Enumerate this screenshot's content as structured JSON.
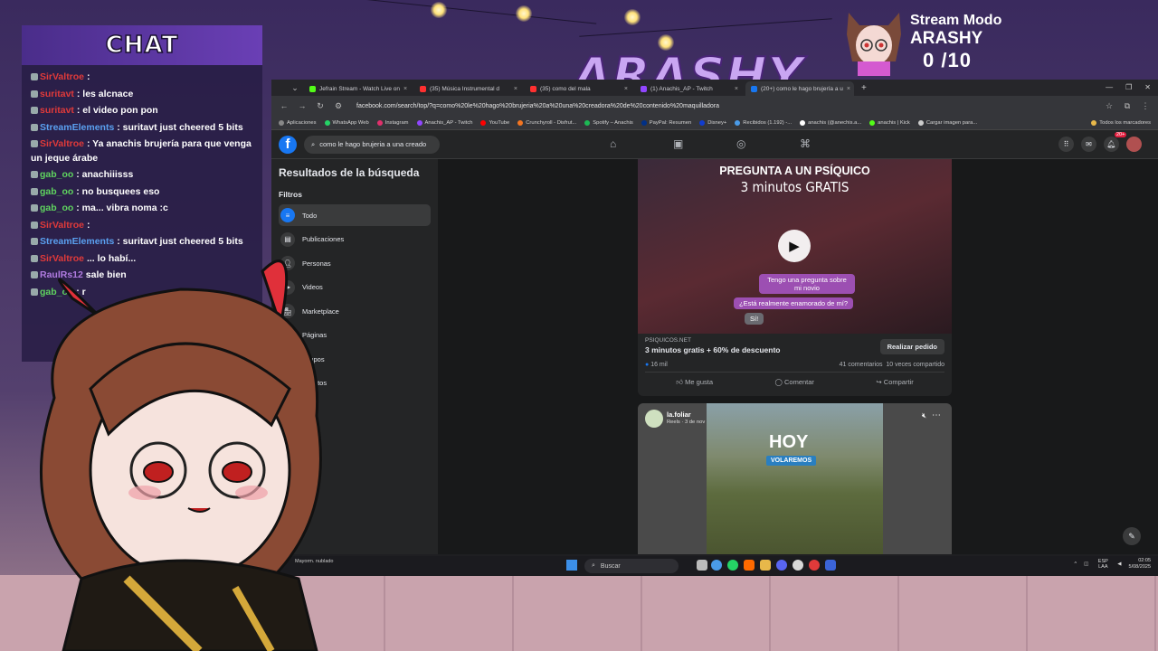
{
  "chat": {
    "title": "CHAT",
    "messages": [
      {
        "user": "SirValtroe",
        "text": ":",
        "user_color": "red"
      },
      {
        "user": "suritavt",
        "text": ": les alcnace",
        "user_color": "red"
      },
      {
        "user": "suritavt",
        "text": ": el video pon pon",
        "user_color": "red"
      },
      {
        "user": "StreamElements",
        "text": ": suritavt just cheered 5 bits",
        "user_color": "blue"
      },
      {
        "user": "SirValtroe",
        "text": ": Ya anachis brujería para que venga un jeque árabe",
        "user_color": "red"
      },
      {
        "user": "gab_oo",
        "text": ": anachiiisss",
        "user_color": "green"
      },
      {
        "user": "gab_oo",
        "text": ": no busquees eso",
        "user_color": "green"
      },
      {
        "user": "gab_oo",
        "text": ": ma... vibra noma :c",
        "user_color": "green"
      },
      {
        "user": "SirValtroe",
        "text": ":",
        "user_color": "red"
      },
      {
        "user": "StreamElements",
        "text": ": suritavt just cheered 5 bits",
        "user_color": "blue"
      },
      {
        "user": "SirValtroe",
        "text": "... lo habí...",
        "user_color": "red"
      },
      {
        "user": "RaulRs12",
        "text": "sale bien",
        "user_color": "purple"
      },
      {
        "user": "gab_oo",
        "text": ": r",
        "user_color": "green"
      }
    ]
  },
  "overlay": {
    "logo": "ARASHY",
    "mode_label": "Stream Modo",
    "mode_name": "ARASHY",
    "counter": "0  /10"
  },
  "browser": {
    "tabs": [
      {
        "label": "Jefrain Stream - Watch Live on",
        "color": "#53fc18"
      },
      {
        "label": "(35) Música Instrumental d",
        "color": "#ff3030"
      },
      {
        "label": "(35) como del mala",
        "color": "#ff3030"
      },
      {
        "label": "(1) Anachis_AP - Twitch",
        "color": "#9146ff"
      },
      {
        "label": "(20+) como le hago brujería a u",
        "color": "#1877f2"
      }
    ],
    "url": "facebook.com/search/top/?q=como%20le%20hago%20brujeria%20a%20una%20creadora%20de%20contenido%20maquilladora",
    "bookmarks": [
      "Aplicaciones",
      "WhatsApp Web",
      "Instagram",
      "Anachis_AP - Twitch",
      "YouTube",
      "Crunchyroll - Disfrut...",
      "Spotify – Anachis",
      "PayPal: Resumen",
      "Disney+",
      "Recibidos (1.192) -...",
      "anachis (@anechis.a...",
      "anachis | Kick",
      "Cargar imagen para...",
      "Todos los marcadores"
    ]
  },
  "facebook": {
    "search_text": "como le hago brujeria a una creado",
    "notification_badge": "20+",
    "results_title": "Resultados de la búsqueda",
    "filters_label": "Filtros",
    "filters": [
      "Todo",
      "Publicaciones",
      "Personas",
      "Videos",
      "Marketplace",
      "Páginas",
      "Grupos",
      "Eventos"
    ],
    "ad": {
      "headline": "PREGUNTA A UN PSÍQUICO",
      "subline": "3 minutos GRATIS",
      "bubble1": "Tengo una pregunta sobre mi novio",
      "bubble2": "¿Está realmente enamorado de mí?",
      "bubble3": "Sí!",
      "source": "PSIQUICOS.NET",
      "title": "3 minutos gratis + 60% de descuento",
      "cta": "Realizar pedido",
      "likes": "16 mil",
      "comments": "41 comentarios",
      "shares": "10 veces compartido",
      "like_label": "Me gusta",
      "comment_label": "Comentar",
      "share_label": "Compartir"
    },
    "reel": {
      "user": "la.foliar",
      "time": "Reels · 3 de nov",
      "overlay_big": "HOY",
      "overlay_tag": "VOLAREMOS"
    }
  },
  "taskbar": {
    "weather": "Mayorm. nublado",
    "search": "Buscar",
    "lang": "ESP LAA",
    "time": "02:05",
    "date": "5/08/2025"
  }
}
